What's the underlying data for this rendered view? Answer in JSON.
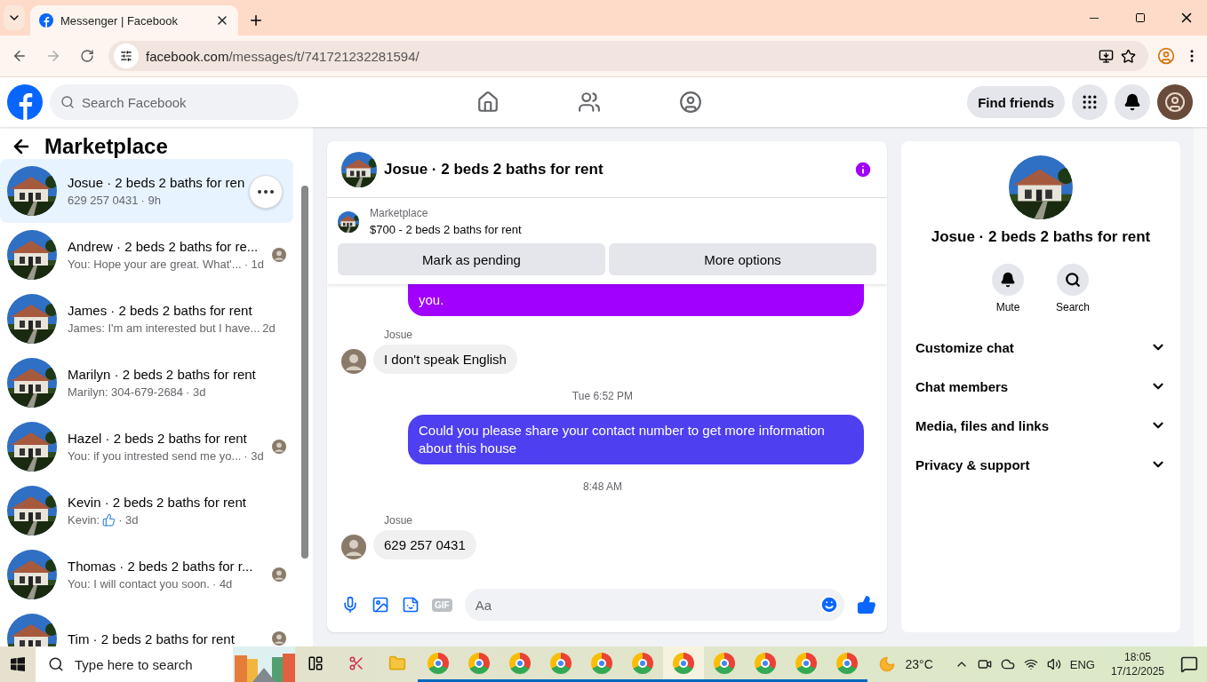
{
  "browser": {
    "tab_title": "Messenger | Facebook",
    "url_host": "facebook.com",
    "url_path": "/messages/t/741721232281594/"
  },
  "header": {
    "search_placeholder": "Search Facebook",
    "find_friends": "Find friends"
  },
  "sidebar": {
    "title": "Marketplace",
    "conversations": [
      {
        "name": "Josue · 2 beds 2 baths for ren",
        "preview": "629 257 0431",
        "time": "· 9h",
        "selected": true,
        "seen": false
      },
      {
        "name": "Andrew · 2 beds 2 baths for re...",
        "preview": "You: Hope your are great. What'...",
        "time": "· 1d",
        "selected": false,
        "seen": true
      },
      {
        "name": "James · 2 beds 2 baths for rent",
        "preview": "James: I'm am interested but I have...",
        "time": "2d",
        "selected": false,
        "seen": false
      },
      {
        "name": "Marilyn · 2 beds 2 baths for rent",
        "preview": "Marilyn: 304-679-2684",
        "time": "· 3d",
        "selected": false,
        "seen": false
      },
      {
        "name": "Hazel · 2 beds 2 baths for rent",
        "preview": "You: if you intrested send me yo...",
        "time": "· 3d",
        "selected": false,
        "seen": true
      },
      {
        "name": "Kevin · 2 beds 2 baths for rent",
        "preview": "Kevin:",
        "like": true,
        "time": "· 3d",
        "selected": false,
        "seen": false
      },
      {
        "name": "Thomas · 2 beds 2 baths for r...",
        "preview": "You: I will contact you soon.",
        "time": "· 4d",
        "selected": false,
        "seen": true
      },
      {
        "name": "Tim · 2 beds 2 baths for rent",
        "selected": false,
        "seen": true
      }
    ]
  },
  "chat": {
    "title": "Josue · 2 beds 2 baths for rent",
    "listing_label": "Marketplace",
    "listing": "$700 - 2 beds 2 baths for rent",
    "buttons": [
      "Mark as pending",
      "More options"
    ],
    "messages": [
      {
        "kind": "outgoing",
        "text": "you.",
        "color": "#a100ff"
      },
      {
        "kind": "incoming",
        "sender": "Josue",
        "text": "I don't speak English"
      },
      {
        "kind": "time",
        "text": "Tue 6:52 PM"
      },
      {
        "kind": "outgoing",
        "text": "Could you please share your contact number to get more information about this house",
        "color": "#4e3ff0"
      },
      {
        "kind": "time",
        "text": "8:48 AM"
      },
      {
        "kind": "incoming",
        "sender": "Josue",
        "text": "629 257 0431"
      }
    ],
    "gif_label": "GIF",
    "composer_placeholder": "Aa"
  },
  "details": {
    "title": "Josue · 2 beds 2 baths for rent",
    "actions": [
      "Mute",
      "Search"
    ],
    "sections": [
      "Customize chat",
      "Chat members",
      "Media, files and links",
      "Privacy & support"
    ]
  },
  "taskbar": {
    "search_placeholder": "Type here to search",
    "temperature": "23°C",
    "language": "ENG",
    "time": "18:05",
    "date": "17/12/2025"
  }
}
